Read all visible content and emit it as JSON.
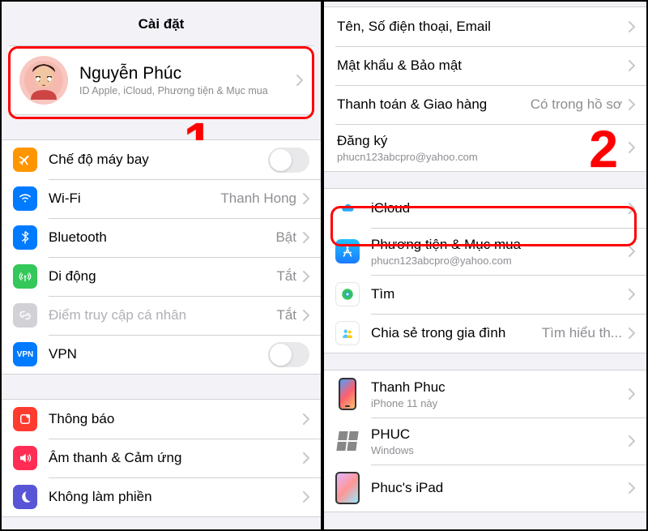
{
  "left": {
    "title": "Cài đặt",
    "profile": {
      "name": "Nguyễn Phúc",
      "desc": "ID Apple, iCloud, Phương tiện & Mục mua"
    },
    "annotation": "1",
    "rows": {
      "airplane": {
        "label": "Chế độ máy bay"
      },
      "wifi": {
        "label": "Wi-Fi",
        "value": "Thanh Hong"
      },
      "bluetooth": {
        "label": "Bluetooth",
        "value": "Bật"
      },
      "cellular": {
        "label": "Di động",
        "value": "Tắt"
      },
      "hotspot": {
        "label": "Điểm truy cập cá nhân",
        "value": "Tắt"
      },
      "vpn": {
        "label": "VPN"
      },
      "notifications": {
        "label": "Thông báo"
      },
      "sounds": {
        "label": "Âm thanh & Cảm ứng"
      },
      "dnd": {
        "label": "Không làm phiền"
      }
    }
  },
  "right": {
    "annotation": "2",
    "rows": {
      "name": {
        "label": "Tên, Số điện thoại, Email"
      },
      "password": {
        "label": "Mật khẩu & Bảo mật"
      },
      "payment": {
        "label": "Thanh toán & Giao hàng",
        "value": "Có trong hồ sơ"
      },
      "subscriptions": {
        "label": "Đăng ký",
        "sub": "phucn123abcpro@yahoo.com"
      },
      "icloud": {
        "label": "iCloud"
      },
      "media": {
        "label": "Phương tiện & Mục mua",
        "sub": "phucn123abcpro@yahoo.com"
      },
      "findmy": {
        "label": "Tìm"
      },
      "family": {
        "label": "Chia sẻ trong gia đình",
        "value": "Tìm hiểu th..."
      },
      "dev1": {
        "label": "Thanh Phuc",
        "sub": "iPhone 11 này"
      },
      "dev2": {
        "label": "PHUC",
        "sub": "Windows"
      },
      "dev3": {
        "label": "Phuc's iPad"
      }
    }
  }
}
